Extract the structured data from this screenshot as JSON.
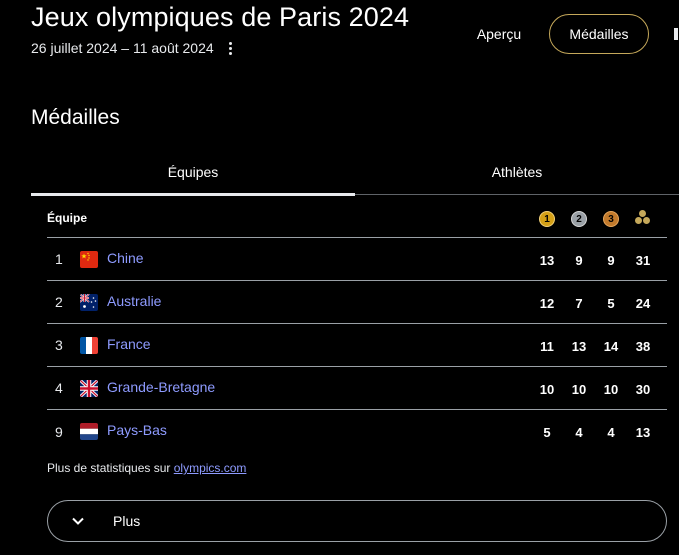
{
  "header": {
    "title": "Jeux olympiques de Paris 2024",
    "dates": "26 juillet 2024 – 11 août 2024",
    "more_icon": "more-vert-icon"
  },
  "nav": {
    "apercu": "Aperçu",
    "medailles": "Médailles"
  },
  "section_title": "Médailles",
  "tabs": [
    {
      "label": "Équipes",
      "active": true
    },
    {
      "label": "Athlètes",
      "active": false
    }
  ],
  "table": {
    "header": {
      "team": "Équipe",
      "gold_icon": "1",
      "silver_icon": "2",
      "bronze_icon": "3",
      "total_icon": "total-medals-icon"
    },
    "rows": [
      {
        "rank": "1",
        "country": "Chine",
        "flag": "china-flag-icon",
        "gold": "13",
        "silver": "9",
        "bronze": "9",
        "total": "31"
      },
      {
        "rank": "2",
        "country": "Australie",
        "flag": "australia-flag-icon",
        "gold": "12",
        "silver": "7",
        "bronze": "5",
        "total": "24"
      },
      {
        "rank": "3",
        "country": "France",
        "flag": "france-flag-icon",
        "gold": "11",
        "silver": "13",
        "bronze": "14",
        "total": "38"
      },
      {
        "rank": "4",
        "country": "Grande-Bretagne",
        "flag": "uk-flag-icon",
        "gold": "10",
        "silver": "10",
        "bronze": "10",
        "total": "30"
      },
      {
        "rank": "9",
        "country": "Pays-Bas",
        "flag": "netherlands-flag-icon",
        "gold": "5",
        "silver": "4",
        "bronze": "4",
        "total": "13"
      }
    ]
  },
  "stats": {
    "prefix": "Plus de statistiques sur ",
    "link": "olympics.com"
  },
  "more_button": {
    "label": "Plus",
    "icon": "chevron-down-icon"
  },
  "colors": {
    "background": "#000000",
    "link": "#8e9bff",
    "accent_border": "#c5a85a",
    "gold": "#d4a017",
    "silver": "#9aa0a6",
    "bronze": "#c27a2c"
  }
}
